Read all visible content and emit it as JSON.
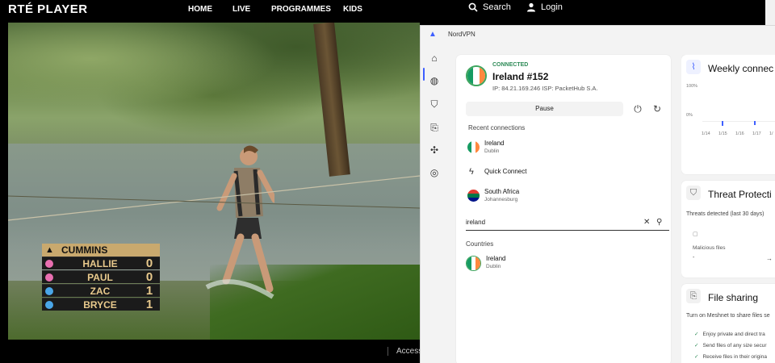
{
  "rte": {
    "logo": "RTÉ PLAYER",
    "nav": [
      "HOME",
      "LIVE",
      "PROGRAMMES",
      "KIDS"
    ],
    "search_label": "Search",
    "login_label": "Login",
    "footer_text": "Access"
  },
  "scoreboard": {
    "title": "CUMMINS",
    "rows": [
      {
        "name": "HALLIE",
        "score": "0",
        "color": "#e86fb0"
      },
      {
        "name": "PAUL",
        "score": "0",
        "color": "#e86fb0"
      },
      {
        "name": "ZAC",
        "score": "1",
        "color": "#4aa6e8"
      },
      {
        "name": "BRYCE",
        "score": "1",
        "color": "#4aa6e8"
      }
    ]
  },
  "nordvpn": {
    "window_title": "NordVPN",
    "sidebar_icons": [
      "home-icon",
      "globe-icon",
      "shield-icon",
      "file-transfer-icon",
      "meshnet-icon",
      "target-icon"
    ],
    "connection": {
      "status": "CONNECTED",
      "server": "Ireland #152",
      "ip_line": "IP: 84.21.169.246    ISP: PacketHub S.A.",
      "pause_label": "Pause"
    },
    "recent_title": "Recent connections",
    "recent": [
      {
        "name": "Ireland",
        "city": "Dublin"
      },
      {
        "name": "Quick Connect",
        "city": ""
      },
      {
        "name": "South Africa",
        "city": "Johannesburg"
      }
    ],
    "search_value": "ireland",
    "countries_title": "Countries",
    "countries": [
      {
        "name": "Ireland",
        "city": "Dublin"
      }
    ],
    "weekly": {
      "title": "Weekly connec",
      "y_labels": [
        "100%",
        "0%"
      ],
      "x_labels": [
        "1/14",
        "1/15",
        "1/16",
        "1/17",
        "1/"
      ]
    },
    "threat": {
      "title": "Threat Protecti",
      "subtitle": "Threats detected (last 30 days)",
      "item": "Malicious files",
      "value": "-"
    },
    "file_sharing": {
      "title": "File sharing",
      "subtitle": "Turn on Meshnet to share files se",
      "checks": [
        "Enjoy private and direct tra",
        "Send files of any size secur",
        "Receive files in their origina"
      ]
    }
  }
}
